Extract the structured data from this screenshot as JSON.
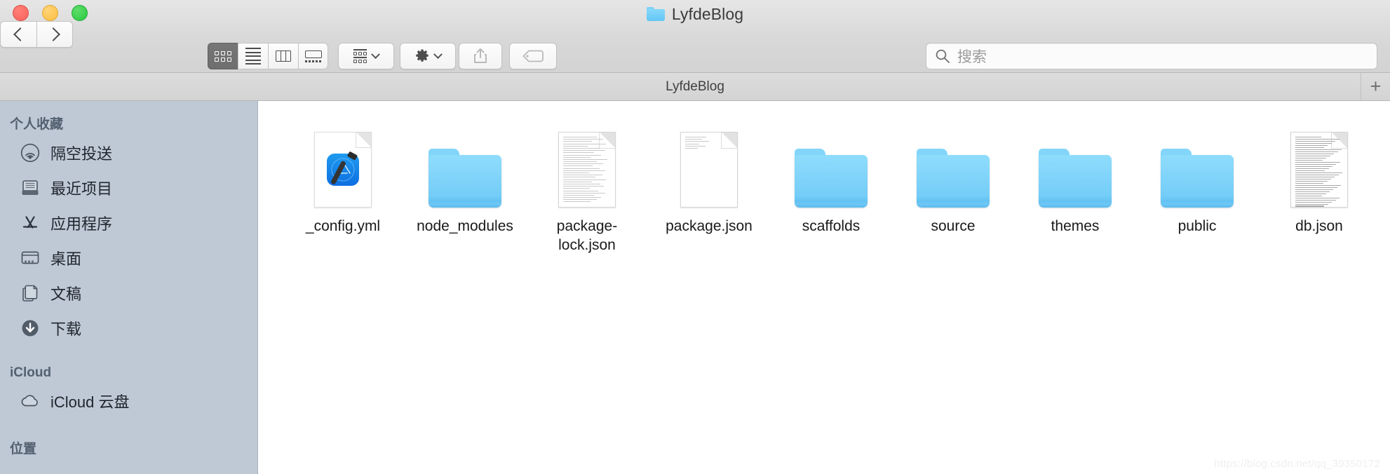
{
  "window": {
    "title": "LyfdeBlog",
    "title_icon": "folder-icon",
    "traffic_lights": {
      "close": "close-button",
      "minimize": "minimize-button",
      "maximize": "maximize-button"
    }
  },
  "toolbar": {
    "back_label": "‹",
    "forward_label": "›",
    "view_modes": [
      {
        "name": "icon-view",
        "icon": "grid-icon",
        "selected": true
      },
      {
        "name": "list-view",
        "icon": "list-icon",
        "selected": false
      },
      {
        "name": "column-view",
        "icon": "columns-icon",
        "selected": false
      },
      {
        "name": "gallery-view",
        "icon": "gallery-icon",
        "selected": false
      }
    ],
    "group_button": {
      "name": "group-by-button",
      "icon": "group-icon"
    },
    "action_button": {
      "name": "action-menu-button",
      "icon": "gear-icon"
    },
    "share_button": {
      "name": "share-button",
      "icon": "share-icon",
      "enabled": false
    },
    "tag_button": {
      "name": "tag-button",
      "icon": "tag-icon",
      "enabled": false
    }
  },
  "search": {
    "placeholder": "搜索",
    "value": "",
    "icon": "search-icon"
  },
  "tabbar": {
    "active_tab": "LyfdeBlog",
    "new_tab_label": "+"
  },
  "sidebar": {
    "sections": [
      {
        "header": "个人收藏",
        "items": [
          {
            "label": "隔空投送",
            "icon": "airdrop-icon"
          },
          {
            "label": "最近项目",
            "icon": "recents-icon"
          },
          {
            "label": "应用程序",
            "icon": "applications-icon"
          },
          {
            "label": "桌面",
            "icon": "desktop-icon"
          },
          {
            "label": "文稿",
            "icon": "documents-icon"
          },
          {
            "label": "下载",
            "icon": "downloads-icon"
          }
        ]
      },
      {
        "header": "iCloud",
        "items": [
          {
            "label": "iCloud 云盘",
            "icon": "icloud-icon"
          }
        ]
      },
      {
        "header": "位置",
        "items": []
      }
    ]
  },
  "files": [
    {
      "name": "_config.yml",
      "kind": "xcode-document"
    },
    {
      "name": "node_modules",
      "kind": "folder"
    },
    {
      "name": "package-lock.json",
      "kind": "text-document"
    },
    {
      "name": "package.json",
      "kind": "plain-document"
    },
    {
      "name": "scaffolds",
      "kind": "folder"
    },
    {
      "name": "source",
      "kind": "folder"
    },
    {
      "name": "themes",
      "kind": "folder"
    },
    {
      "name": "public",
      "kind": "folder"
    },
    {
      "name": "db.json",
      "kind": "dense-document"
    }
  ],
  "watermark": "https://blog.csdn.net/qq_39350172",
  "colors": {
    "sidebar_bg": "#bfc9d6",
    "folder_blue": "#74cdf8",
    "toolbar_bg": "#d8d8d8",
    "selected_view_bg": "#6e6e6e"
  }
}
